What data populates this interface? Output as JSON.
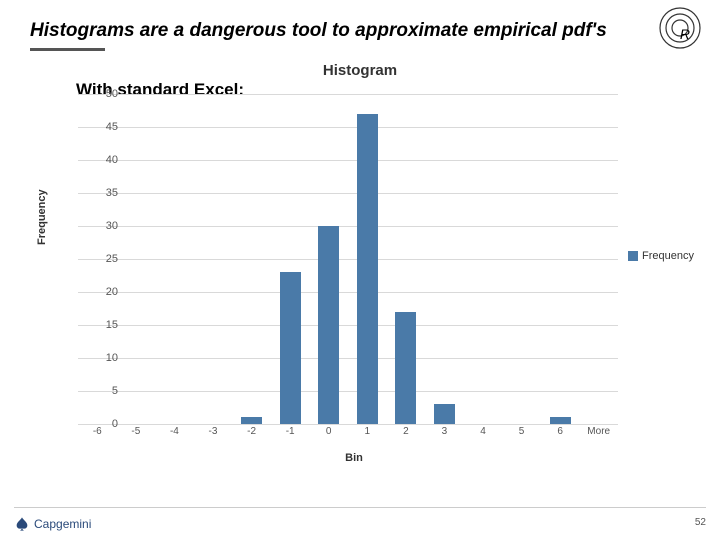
{
  "title": "Histograms are a dangerous tool to approximate empirical pdf's",
  "logo_letter": "R",
  "subtitle": "With standard Excel:",
  "chart_data": {
    "type": "bar",
    "title": "Histogram",
    "xlabel": "Bin",
    "ylabel": "Frequency",
    "categories": [
      "-6",
      "-5",
      "-4",
      "-3",
      "-2",
      "-1",
      "0",
      "1",
      "2",
      "3",
      "4",
      "5",
      "6",
      "More"
    ],
    "values": [
      0,
      0,
      0,
      0,
      1,
      23,
      30,
      47,
      17,
      3,
      0,
      0,
      1,
      0
    ],
    "ylim": [
      0,
      50
    ],
    "ytick_step": 5,
    "legend": "Frequency",
    "bar_color": "#4a7aa8"
  },
  "footer_brand": "Capgemini",
  "page_number": "52"
}
